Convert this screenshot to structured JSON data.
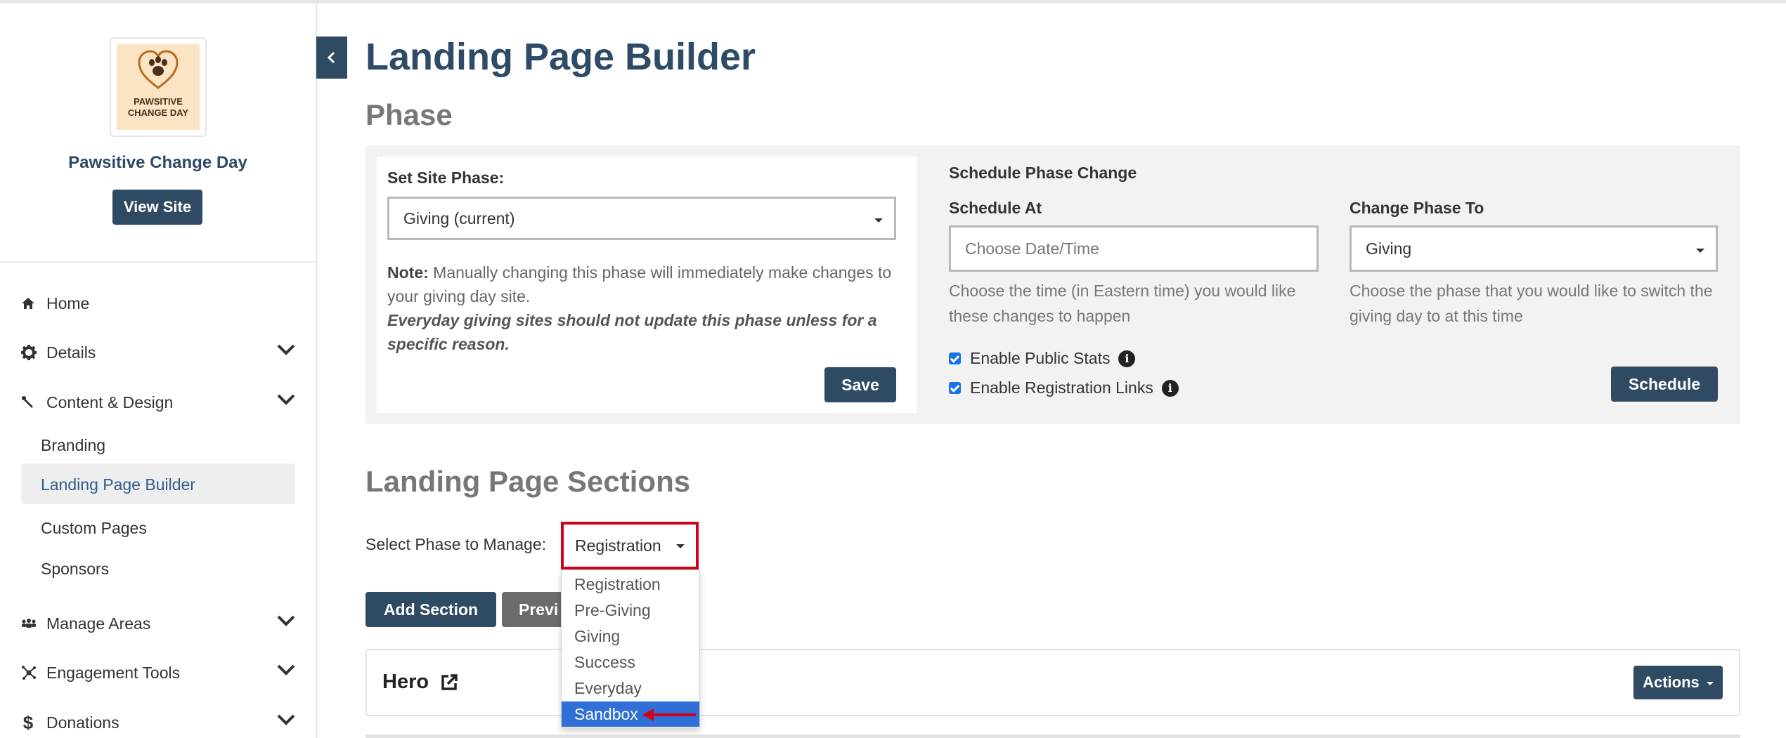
{
  "sidebar": {
    "logo_text_line1": "PAWSITIVE",
    "logo_text_line2": "CHANGE DAY",
    "org_name": "Pawsitive Change Day",
    "view_site_label": "View Site",
    "nav": {
      "home": "Home",
      "details": "Details",
      "content_design": "Content & Design",
      "branding": "Branding",
      "landing_page_builder": "Landing Page Builder",
      "custom_pages": "Custom Pages",
      "sponsors": "Sponsors",
      "manage_areas": "Manage Areas",
      "engagement_tools": "Engagement Tools",
      "donations": "Donations"
    }
  },
  "main": {
    "title": "Landing Page Builder",
    "phase_heading": "Phase",
    "set_site_phase_label": "Set Site Phase:",
    "site_phase_value": "Giving (current)",
    "note_label": "Note:",
    "note_text": "Manually changing this phase will immediately make changes to your giving day site.",
    "note_warning": "Everyday giving sites should not update this phase unless for a specific reason.",
    "save_label": "Save",
    "schedule_heading": "Schedule Phase Change",
    "schedule_at_label": "Schedule At",
    "schedule_at_placeholder": "Choose Date/Time",
    "schedule_at_help": "Choose the time (in Eastern time) you would like these changes to happen",
    "change_phase_to_label": "Change Phase To",
    "change_phase_to_value": "Giving",
    "change_phase_help": "Choose the phase that you would like to switch the giving day to at this time",
    "enable_public_stats": "Enable Public Stats",
    "enable_registration_links": "Enable Registration Links",
    "schedule_label": "Schedule",
    "sections_heading": "Landing Page Sections",
    "select_phase_label": "Select Phase to Manage:",
    "select_phase_value": "Registration",
    "phase_options": [
      "Registration",
      "Pre-Giving",
      "Giving",
      "Success",
      "Everyday",
      "Sandbox"
    ],
    "add_section_label": "Add Section",
    "preview_label": "Previ",
    "hero_title": "Hero",
    "actions_label": "Actions"
  },
  "colors": {
    "primary": "#2f4a63",
    "highlight_border": "#d0021b",
    "selected_option": "#2f6fd6"
  }
}
